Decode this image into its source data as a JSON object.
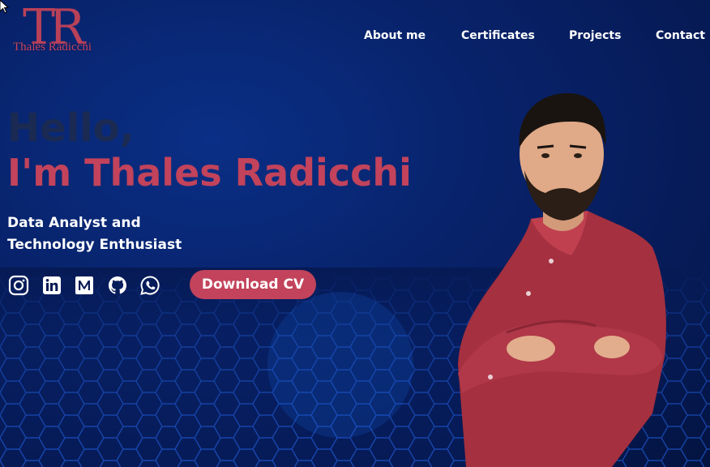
{
  "logo": {
    "monogram": "TR",
    "name": "Thales Radicchi"
  },
  "nav": {
    "items": [
      "About me",
      "Certificates",
      "Projects",
      "Contact"
    ]
  },
  "hero": {
    "greeting": "Hello,",
    "headline": "I'm Thales Radicchi",
    "subtitle_line1": "Data Analyst and",
    "subtitle_line2": "Technology Enthusiast",
    "download_label": "Download CV"
  },
  "social": [
    "instagram-icon",
    "linkedin-icon",
    "medium-icon",
    "github-icon",
    "whatsapp-icon"
  ],
  "colors": {
    "accent": "#c2435b",
    "background": "#061a55",
    "greeting": "#1b2a52",
    "text": "#ffffff"
  }
}
